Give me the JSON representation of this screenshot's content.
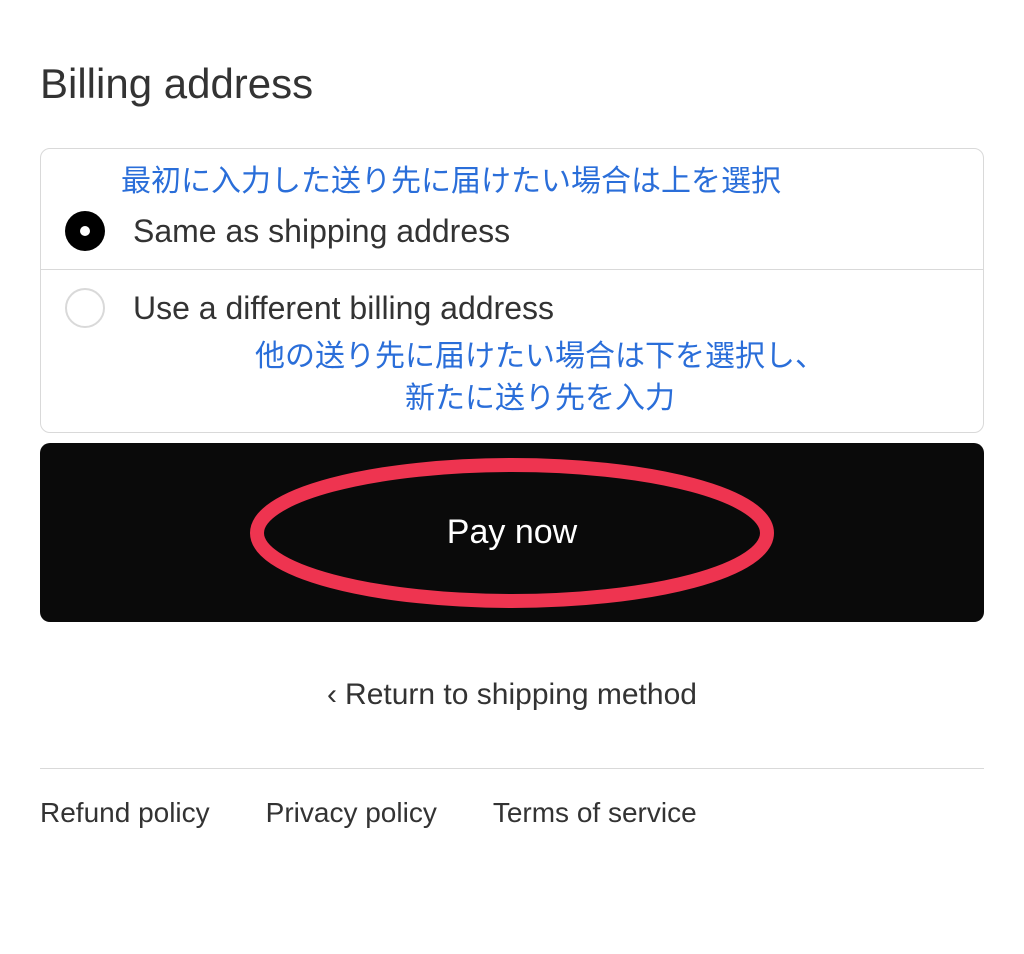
{
  "section": {
    "title": "Billing address"
  },
  "options": {
    "same": {
      "label": "Same as shipping address",
      "annotation": "最初に入力した送り先に届けたい場合は上を選択",
      "selected": true
    },
    "different": {
      "label": "Use a different billing address",
      "annotation_line1": "他の送り先に届けたい場合は下を選択し、",
      "annotation_line2": "新たに送り先を入力",
      "selected": false
    }
  },
  "pay_button": {
    "label": "Pay now"
  },
  "return_link": {
    "label": "Return to shipping method"
  },
  "footer": {
    "refund": "Refund policy",
    "privacy": "Privacy policy",
    "terms": "Terms of service"
  },
  "colors": {
    "annotation_blue": "#2a6ed9",
    "annotation_red": "#ee3450"
  }
}
